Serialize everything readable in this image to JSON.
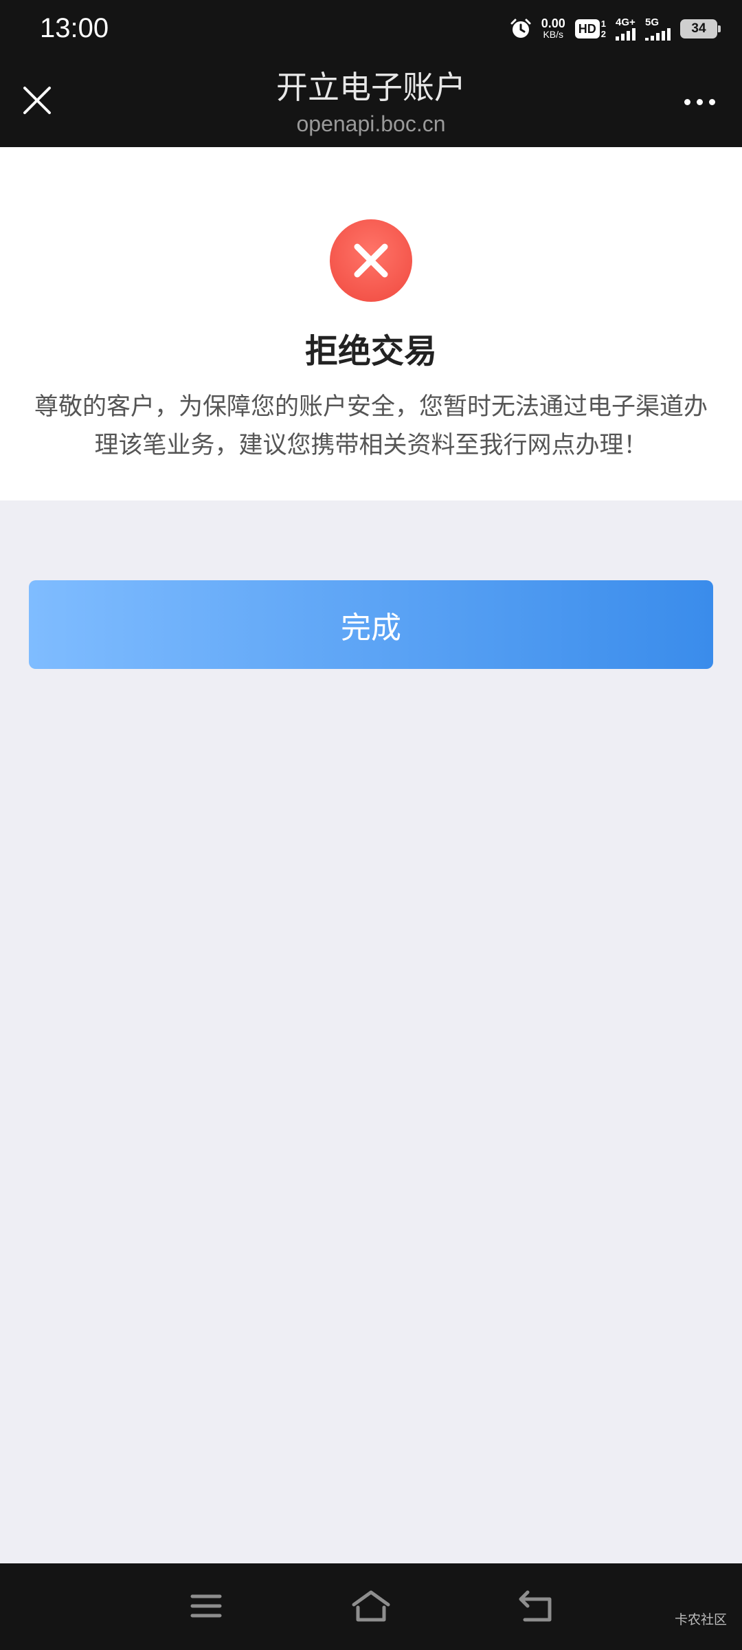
{
  "status_bar": {
    "time": "13:00",
    "net_speed_value": "0.00",
    "net_speed_unit": "KB/s",
    "hd_label": "HD",
    "hd_sub_top": "1",
    "hd_sub_bottom": "2",
    "signal1_label": "4G+",
    "signal2_label": "5G",
    "battery": "34",
    "icons": [
      "alarm-icon",
      "hd-icon",
      "signal-icon",
      "signal-icon",
      "battery-icon"
    ]
  },
  "header": {
    "title": "开立电子账户",
    "subtitle": "openapi.boc.cn",
    "close_icon": "close-icon",
    "more_icon": "more-icon"
  },
  "result": {
    "icon": "error-icon",
    "title": "拒绝交易",
    "message": "尊敬的客户，为保障您的账户安全，您暂时无法通过电子渠道办理该笔业务，建议您携带相关资料至我行网点办理！"
  },
  "actions": {
    "done_label": "完成"
  },
  "nav_bar": {
    "icons": [
      "menu-icon",
      "home-icon",
      "back-icon"
    ],
    "watermark": "卡农社区"
  },
  "colors": {
    "status_bar_bg": "#141414",
    "page_bg": "#eeeef4",
    "error_red": "#f0493f",
    "button_gradient_start": "#7fbcff",
    "button_gradient_end": "#3a8ceb"
  }
}
